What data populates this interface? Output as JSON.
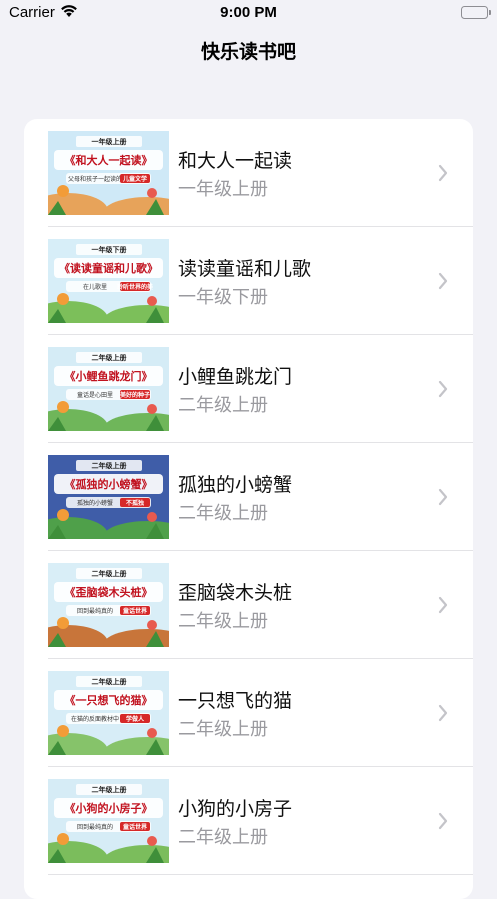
{
  "status": {
    "carrier": "Carrier",
    "time": "9:00 PM"
  },
  "nav": {
    "title": "快乐读书吧"
  },
  "books": [
    {
      "title": "和大人一起读",
      "grade": "一年级上册",
      "cover_top": "一年级上册",
      "cover_main": "和大人一起读",
      "cover_sub": "父母和孩子一起读的",
      "cover_tag": "儿童文学",
      "sky": "#cfe9f7",
      "ground": "#e7a35a"
    },
    {
      "title": "读读童谣和儿歌",
      "grade": "一年级下册",
      "cover_top": "一年级下册",
      "cover_main": "读读童谣和儿歌",
      "cover_sub": "在儿歌里",
      "cover_tag": "聆听世界的美",
      "sky": "#d7eef8",
      "ground": "#7cbf5a"
    },
    {
      "title": "小鲤鱼跳龙门",
      "grade": "二年级上册",
      "cover_top": "二年级上册",
      "cover_main": "小鲤鱼跳龙门",
      "cover_sub": "童话是心田里",
      "cover_tag": "美好的种子",
      "sky": "#d5ecf6",
      "ground": "#6fb65a"
    },
    {
      "title": "孤独的小螃蟹",
      "grade": "二年级上册",
      "cover_top": "二年级上册",
      "cover_main": "孤独的小螃蟹",
      "cover_sub": "孤独的小螃蟹",
      "cover_tag": "不孤独",
      "sky": "#3f5da8",
      "ground": "#4fa04a"
    },
    {
      "title": "歪脑袋木头桩",
      "grade": "二年级上册",
      "cover_top": "二年级上册",
      "cover_main": "歪脑袋木头桩",
      "cover_sub": "回到最纯真的",
      "cover_tag": "童话世界",
      "sky": "#d9eef7",
      "ground": "#c8753a"
    },
    {
      "title": "一只想飞的猫",
      "grade": "二年级上册",
      "cover_top": "二年级上册",
      "cover_main": "一只想飞的猫",
      "cover_sub": "在猫的反面教材中",
      "cover_tag": "学做人",
      "sky": "#d7edf7",
      "ground": "#86c36a"
    },
    {
      "title": "小狗的小房子",
      "grade": "二年级上册",
      "cover_top": "二年级上册",
      "cover_main": "小狗的小房子",
      "cover_sub": "回到最纯真的",
      "cover_tag": "童话世界",
      "sky": "#d6ecf6",
      "ground": "#7bbd5c"
    }
  ]
}
